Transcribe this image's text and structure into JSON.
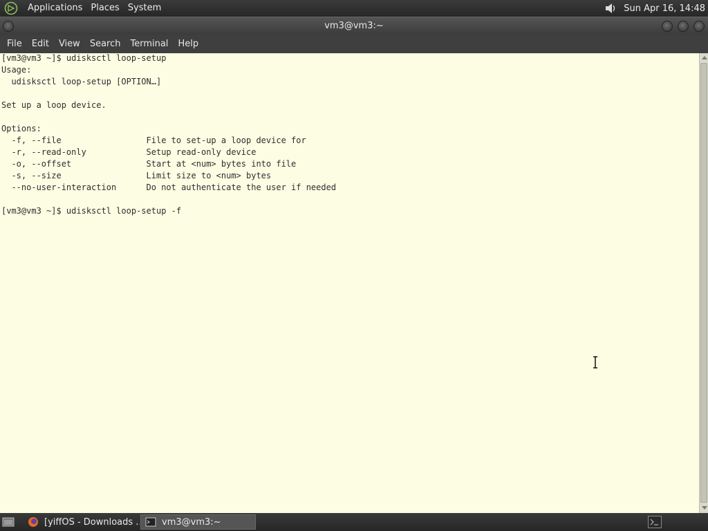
{
  "top_panel": {
    "menus": [
      "Applications",
      "Places",
      "System"
    ],
    "clock": "Sun Apr 16, 14:48",
    "icons": {
      "logo": "distro-logo-icon",
      "volume": "volume-icon"
    }
  },
  "window": {
    "title": "vm3@vm3:~"
  },
  "menubar": {
    "items": [
      "File",
      "Edit",
      "View",
      "Search",
      "Terminal",
      "Help"
    ]
  },
  "terminal": {
    "lines": [
      "[vm3@vm3 ~]$ udisksctl loop-setup",
      "Usage:",
      "  udisksctl loop-setup [OPTION…]",
      "",
      "Set up a loop device.",
      "",
      "Options:",
      "  -f, --file                 File to set-up a loop device for",
      "  -r, --read-only            Setup read-only device",
      "  -o, --offset               Start at <num> bytes into file",
      "  -s, --size                 Limit size to <num> bytes",
      "  --no-user-interaction      Do not authenticate the user if needed",
      "",
      "[vm3@vm3 ~]$ udisksctl loop-setup -f"
    ],
    "colors": {
      "background": "#fdfde4",
      "foreground": "#2e2e2e"
    }
  },
  "taskbar": {
    "tasks": [
      {
        "label": "[yiffOS - Downloads ...",
        "icon": "firefox-icon",
        "active": false
      },
      {
        "label": "vm3@vm3:~",
        "icon": "terminal-icon",
        "active": true
      }
    ],
    "icons": {
      "show_desktop": "show-desktop-icon",
      "tray": "terminal-tray-icon"
    }
  }
}
